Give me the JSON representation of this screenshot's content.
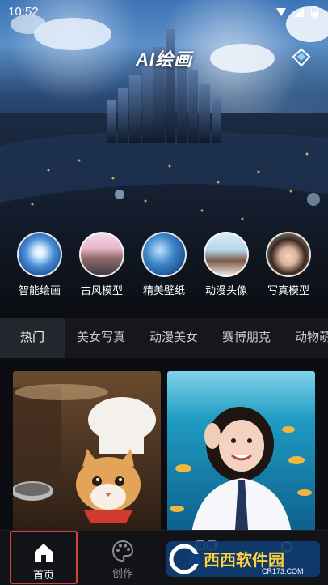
{
  "status_bar": {
    "time": "10:52"
  },
  "header": {
    "title": "AI绘画"
  },
  "categories": [
    {
      "label": "智能绘画",
      "icon": "ocean-sunrise-thumbnail"
    },
    {
      "label": "古风模型",
      "icon": "ancient-pavilion-thumbnail"
    },
    {
      "label": "精美壁纸",
      "icon": "blue-wave-thumbnail"
    },
    {
      "label": "动漫头像",
      "icon": "anime-girl-thumbnail"
    },
    {
      "label": "写真模型",
      "icon": "portrait-woman-thumbnail"
    }
  ],
  "tabs": [
    {
      "label": "热门",
      "active": true
    },
    {
      "label": "美女写真",
      "active": false
    },
    {
      "label": "动漫美女",
      "active": false
    },
    {
      "label": "赛博朋克",
      "active": false
    },
    {
      "label": "动物萌",
      "active": false
    }
  ],
  "gallery": [
    {
      "description_icon": "chef-cat-image"
    },
    {
      "description_icon": "underwater-girl-image"
    }
  ],
  "bottom_nav": [
    {
      "label": "首页",
      "icon": "home-icon",
      "active": true
    },
    {
      "label": "创作",
      "icon": "palette-icon",
      "active": false
    }
  ],
  "watermark": {
    "text_main": "西西软件园",
    "text_sub": "CR173.COM"
  },
  "colors": {
    "accent_red": "#d6423a",
    "tab_active_bg": "#24272e",
    "background": "#0b0d12"
  }
}
